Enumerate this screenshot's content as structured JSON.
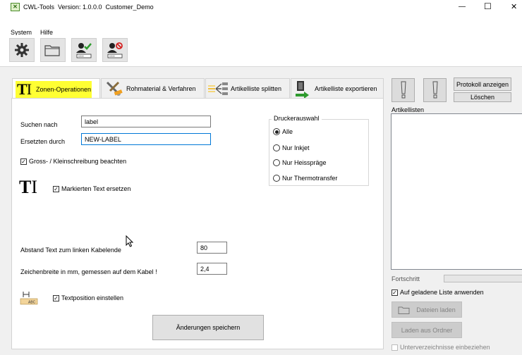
{
  "window": {
    "title": "CWL-Tools  Version: 1.0.0.0  Customer_Demo",
    "controls": {
      "minimize": "—",
      "maximize": "☐",
      "close": "✕"
    }
  },
  "menu": {
    "items": [
      "System",
      "Hilfe"
    ]
  },
  "toolbar": {
    "buttons": [
      {
        "icon": "gear-icon"
      },
      {
        "icon": "folder-icon"
      },
      {
        "icon": "user-check-icon"
      },
      {
        "icon": "user-block-icon"
      }
    ]
  },
  "tabs": [
    {
      "label": "Zonen-Operationen",
      "icon": "text-cursor-icon",
      "active": true
    },
    {
      "label": "Rohmaterial & Verfahren",
      "icon": "tools-icon",
      "active": false
    },
    {
      "label": "Artikelliste splitten",
      "icon": "split-icon",
      "active": false
    },
    {
      "label": "Artikelliste exportieren",
      "icon": "export-icon",
      "active": false
    }
  ],
  "zone": {
    "search_label": "Suchen nach",
    "search_value": "label",
    "replace_label": "Ersetzten durch",
    "replace_value": "NEW-LABEL",
    "case_checkbox_label": "Gross- / Kleinschreibung beachten",
    "case_checked": true,
    "marked_text_label": "Markierten Text ersetzen",
    "marked_checked": true,
    "distance_label": "Abstand Text zum linken Kabelende",
    "distance_value": "80",
    "charwidth_label": "Zeichenbreite in mm, gemessen auf dem Kabel !",
    "charwidth_value": "2,4",
    "textpos_label": "Textposition einstellen",
    "textpos_checked": true,
    "save_button": "Änderungen speichern"
  },
  "printer": {
    "title": "Druckerauswahl",
    "options": [
      "Alle",
      "Nur Inkjet",
      "Nur Heisspräge",
      "Nur Thermotransfer"
    ],
    "selected": "Alle"
  },
  "right_panel": {
    "protocol_button": "Protokoll anzeigen",
    "clear_button": "Löschen",
    "list_label": "Artikellisten",
    "progress_label": "Fortschritt",
    "progress_value": 0,
    "apply_label": "Auf geladene Liste anwenden",
    "apply_checked": true,
    "load_files_button": "Dateien laden",
    "load_folder_button": "Laden aus Ordner",
    "subfolders_label": "Unterverzeichnisse einbeziehen",
    "subfolders_checked": false
  },
  "colors": {
    "active_tab_highlight": "#ffff33",
    "focus_border": "#0078d7",
    "check_green": "#2e9b2e",
    "block_red": "#d42020"
  }
}
